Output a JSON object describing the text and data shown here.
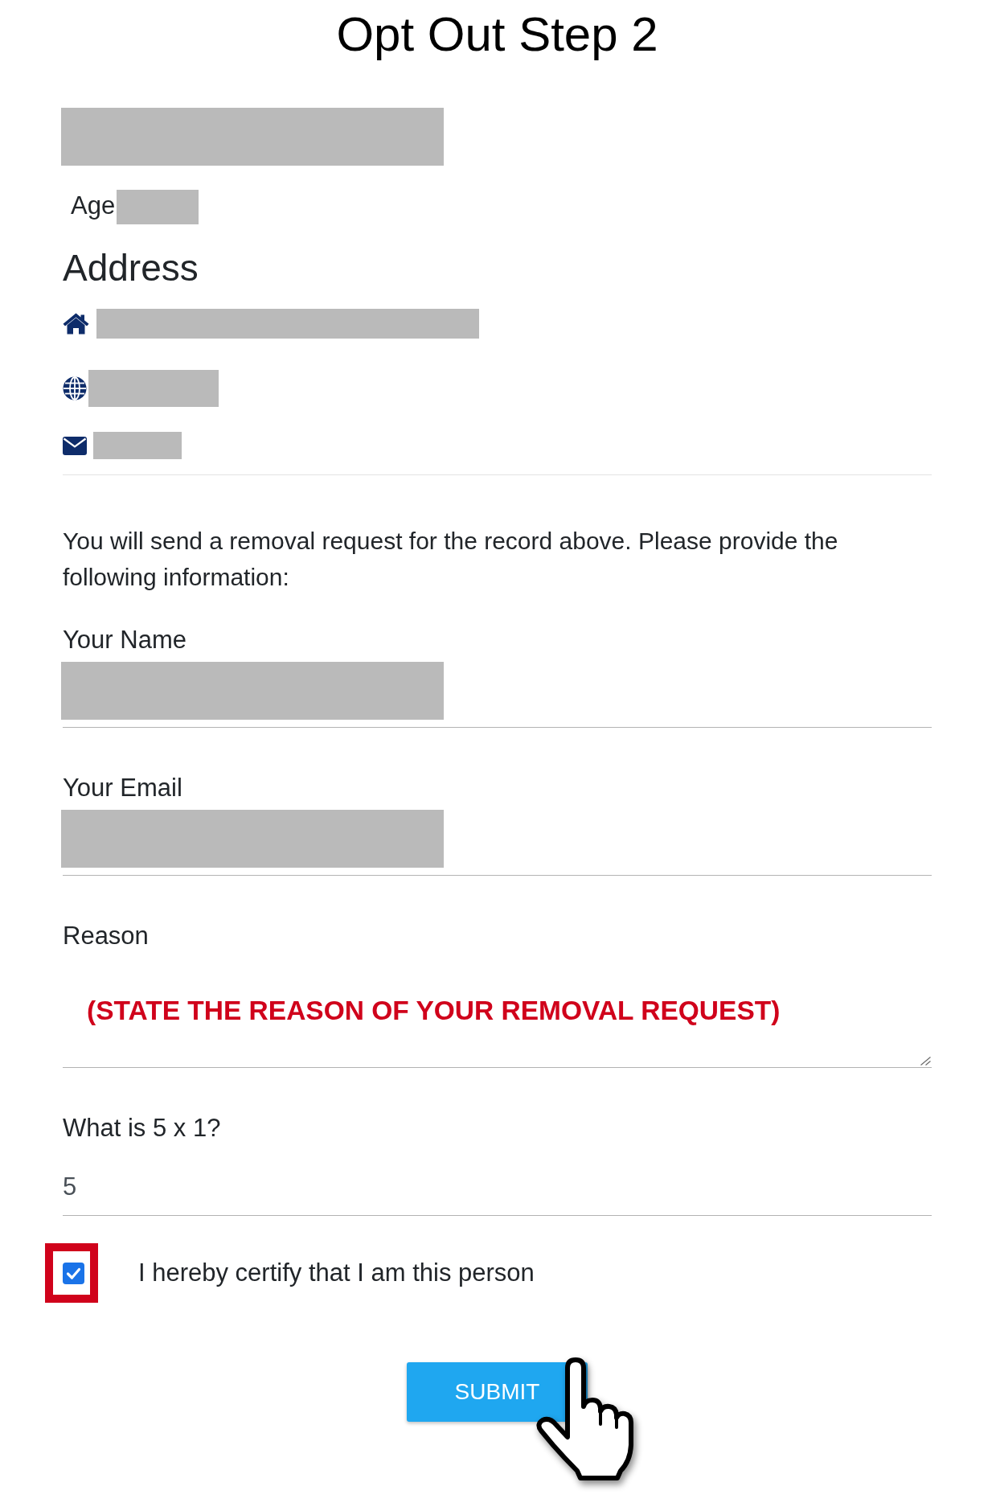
{
  "title": "Opt Out Step 2",
  "record": {
    "name": {
      "redacted": true
    },
    "age": {
      "label": "Age",
      "redacted": true
    },
    "address": {
      "heading": "Address",
      "lines": [
        {
          "kind": "street",
          "redacted": true
        },
        {
          "kind": "region",
          "redacted": true
        },
        {
          "kind": "postal",
          "redacted": true
        }
      ]
    }
  },
  "intro": "You will send a removal request for the record above. Please provide the following information:",
  "form": {
    "fields": [
      {
        "kind": "text",
        "label": "Your Name",
        "redacted": true
      },
      {
        "kind": "text",
        "label": "Your Email",
        "redacted": true
      },
      {
        "kind": "textarea",
        "label": "Reason",
        "value": "(STATE THE REASON OF YOUR REMOVAL REQUEST)"
      },
      {
        "kind": "text",
        "label": "What is 5 x 1?",
        "value": "5"
      }
    ]
  },
  "certify": {
    "label": "I hereby certify that I am this person",
    "checked": true,
    "highlighted": true
  },
  "submit": {
    "label": "SUBMIT",
    "hovered": true
  }
}
